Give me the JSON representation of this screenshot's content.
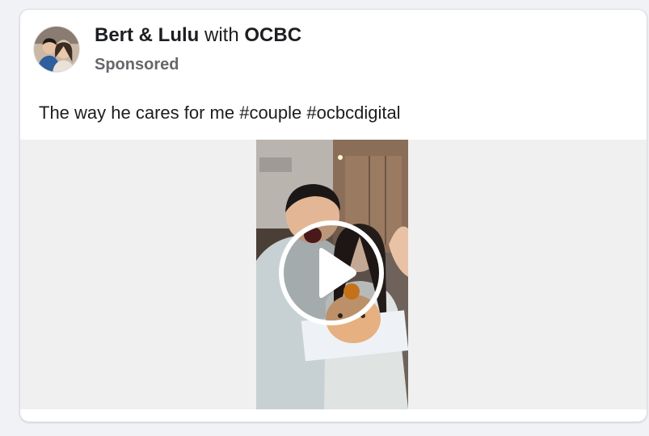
{
  "post": {
    "author": "Bert & Lulu",
    "with_text": "with",
    "partner": "OCBC",
    "sponsored_label": "Sponsored",
    "caption": "The way he cares for me #couple #ocbcdigital"
  },
  "icons": {
    "avatar": "profile-photo-couple",
    "play": "play-icon"
  },
  "colors": {
    "text_primary": "#1c1e21",
    "text_secondary": "#65676b",
    "card_bg": "#ffffff",
    "media_bg": "#f0f0f0"
  }
}
